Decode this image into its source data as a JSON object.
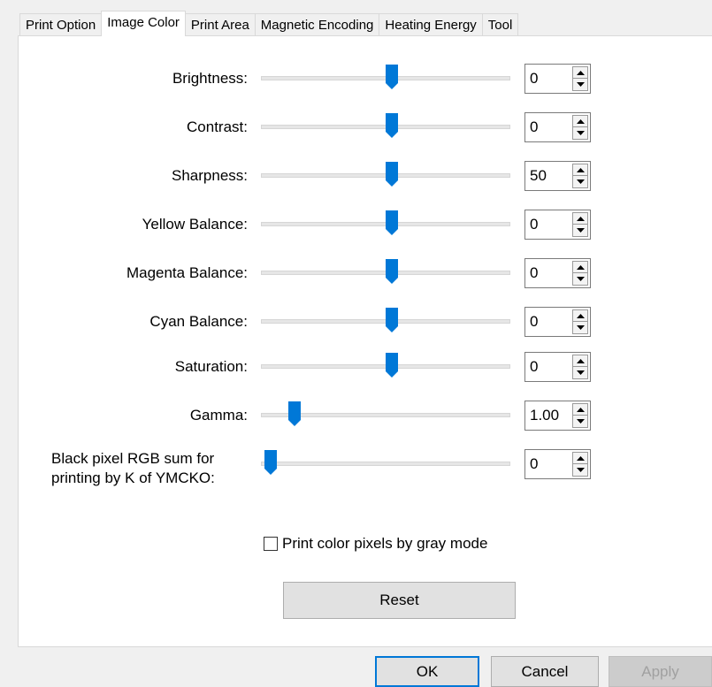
{
  "tabs": [
    {
      "label": "Print Option"
    },
    {
      "label": "Image Color"
    },
    {
      "label": "Print Area"
    },
    {
      "label": "Magnetic Encoding"
    },
    {
      "label": "Heating Energy"
    },
    {
      "label": "Tool"
    }
  ],
  "sliders": [
    {
      "label": "Brightness:",
      "value": "0",
      "position": 0.5
    },
    {
      "label": "Contrast:",
      "value": "0",
      "position": 0.5
    },
    {
      "label": "Sharpness:",
      "value": "50",
      "position": 0.5
    },
    {
      "label": "Yellow Balance:",
      "value": "0",
      "position": 0.5
    },
    {
      "label": "Magenta Balance:",
      "value": "0",
      "position": 0.5
    },
    {
      "label": "Cyan Balance:",
      "value": "0",
      "position": 0.5
    },
    {
      "label": "Saturation:",
      "value": "0",
      "position": 0.5
    },
    {
      "label": "Gamma:",
      "value": "1.00",
      "position": 0.1
    },
    {
      "label_line1": "Black pixel RGB sum for",
      "label_line2": "printing by K of YMCKO:",
      "value": "0",
      "position": 0.0
    }
  ],
  "gray_mode": {
    "label": "Print color pixels by gray mode",
    "checked": false
  },
  "reset_label": "Reset",
  "footer": {
    "ok": "OK",
    "cancel": "Cancel",
    "apply": "Apply"
  },
  "colors": {
    "accent": "#0078d7"
  }
}
